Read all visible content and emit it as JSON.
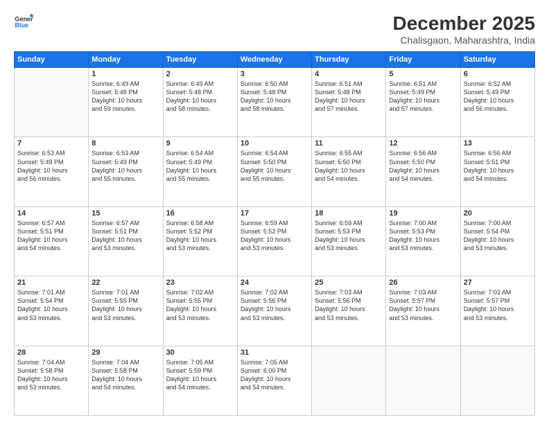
{
  "header": {
    "logo_line1": "General",
    "logo_line2": "Blue",
    "main_title": "December 2025",
    "subtitle": "Chalisgaon, Maharashtra, India"
  },
  "days_of_week": [
    "Sunday",
    "Monday",
    "Tuesday",
    "Wednesday",
    "Thursday",
    "Friday",
    "Saturday"
  ],
  "weeks": [
    [
      {
        "day": "",
        "info": ""
      },
      {
        "day": "1",
        "info": "Sunrise: 6:49 AM\nSunset: 5:48 PM\nDaylight: 10 hours\nand 59 minutes."
      },
      {
        "day": "2",
        "info": "Sunrise: 6:49 AM\nSunset: 5:48 PM\nDaylight: 10 hours\nand 58 minutes."
      },
      {
        "day": "3",
        "info": "Sunrise: 6:50 AM\nSunset: 5:48 PM\nDaylight: 10 hours\nand 58 minutes."
      },
      {
        "day": "4",
        "info": "Sunrise: 6:51 AM\nSunset: 5:48 PM\nDaylight: 10 hours\nand 57 minutes."
      },
      {
        "day": "5",
        "info": "Sunrise: 6:51 AM\nSunset: 5:49 PM\nDaylight: 10 hours\nand 57 minutes."
      },
      {
        "day": "6",
        "info": "Sunrise: 6:52 AM\nSunset: 5:49 PM\nDaylight: 10 hours\nand 56 minutes."
      }
    ],
    [
      {
        "day": "7",
        "info": "Sunrise: 6:53 AM\nSunset: 5:49 PM\nDaylight: 10 hours\nand 56 minutes."
      },
      {
        "day": "8",
        "info": "Sunrise: 6:53 AM\nSunset: 5:49 PM\nDaylight: 10 hours\nand 55 minutes."
      },
      {
        "day": "9",
        "info": "Sunrise: 6:54 AM\nSunset: 5:49 PM\nDaylight: 10 hours\nand 55 minutes."
      },
      {
        "day": "10",
        "info": "Sunrise: 6:54 AM\nSunset: 5:50 PM\nDaylight: 10 hours\nand 55 minutes."
      },
      {
        "day": "11",
        "info": "Sunrise: 6:55 AM\nSunset: 5:50 PM\nDaylight: 10 hours\nand 54 minutes."
      },
      {
        "day": "12",
        "info": "Sunrise: 6:56 AM\nSunset: 5:50 PM\nDaylight: 10 hours\nand 54 minutes."
      },
      {
        "day": "13",
        "info": "Sunrise: 6:56 AM\nSunset: 5:51 PM\nDaylight: 10 hours\nand 54 minutes."
      }
    ],
    [
      {
        "day": "14",
        "info": "Sunrise: 6:57 AM\nSunset: 5:51 PM\nDaylight: 10 hours\nand 54 minutes."
      },
      {
        "day": "15",
        "info": "Sunrise: 6:57 AM\nSunset: 5:51 PM\nDaylight: 10 hours\nand 53 minutes."
      },
      {
        "day": "16",
        "info": "Sunrise: 6:58 AM\nSunset: 5:52 PM\nDaylight: 10 hours\nand 53 minutes."
      },
      {
        "day": "17",
        "info": "Sunrise: 6:59 AM\nSunset: 5:52 PM\nDaylight: 10 hours\nand 53 minutes."
      },
      {
        "day": "18",
        "info": "Sunrise: 6:59 AM\nSunset: 5:53 PM\nDaylight: 10 hours\nand 53 minutes."
      },
      {
        "day": "19",
        "info": "Sunrise: 7:00 AM\nSunset: 5:53 PM\nDaylight: 10 hours\nand 53 minutes."
      },
      {
        "day": "20",
        "info": "Sunrise: 7:00 AM\nSunset: 5:54 PM\nDaylight: 10 hours\nand 53 minutes."
      }
    ],
    [
      {
        "day": "21",
        "info": "Sunrise: 7:01 AM\nSunset: 5:54 PM\nDaylight: 10 hours\nand 53 minutes."
      },
      {
        "day": "22",
        "info": "Sunrise: 7:01 AM\nSunset: 5:55 PM\nDaylight: 10 hours\nand 53 minutes."
      },
      {
        "day": "23",
        "info": "Sunrise: 7:02 AM\nSunset: 5:55 PM\nDaylight: 10 hours\nand 53 minutes."
      },
      {
        "day": "24",
        "info": "Sunrise: 7:02 AM\nSunset: 5:56 PM\nDaylight: 10 hours\nand 53 minutes."
      },
      {
        "day": "25",
        "info": "Sunrise: 7:03 AM\nSunset: 5:56 PM\nDaylight: 10 hours\nand 53 minutes."
      },
      {
        "day": "26",
        "info": "Sunrise: 7:03 AM\nSunset: 5:57 PM\nDaylight: 10 hours\nand 53 minutes."
      },
      {
        "day": "27",
        "info": "Sunrise: 7:03 AM\nSunset: 5:57 PM\nDaylight: 10 hours\nand 53 minutes."
      }
    ],
    [
      {
        "day": "28",
        "info": "Sunrise: 7:04 AM\nSunset: 5:58 PM\nDaylight: 10 hours\nand 53 minutes."
      },
      {
        "day": "29",
        "info": "Sunrise: 7:04 AM\nSunset: 5:58 PM\nDaylight: 10 hours\nand 54 minutes."
      },
      {
        "day": "30",
        "info": "Sunrise: 7:05 AM\nSunset: 5:59 PM\nDaylight: 10 hours\nand 54 minutes."
      },
      {
        "day": "31",
        "info": "Sunrise: 7:05 AM\nSunset: 6:00 PM\nDaylight: 10 hours\nand 54 minutes."
      },
      {
        "day": "",
        "info": ""
      },
      {
        "day": "",
        "info": ""
      },
      {
        "day": "",
        "info": ""
      }
    ]
  ]
}
